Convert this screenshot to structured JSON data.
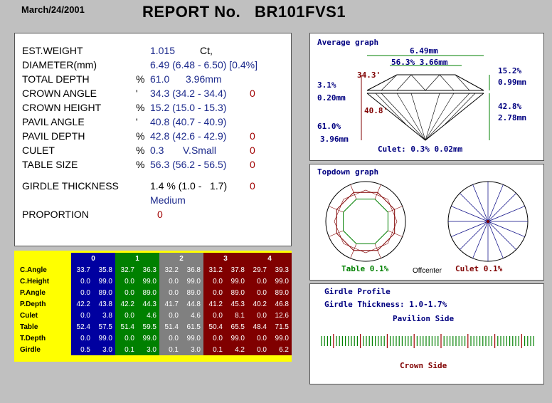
{
  "header": {
    "date": "March/24/2001",
    "title": "REPORT No.   BR101FVS1"
  },
  "measurements": [
    {
      "label": "EST.WEIGHT",
      "unit": "",
      "value": "1.015",
      "extra": "Ct,",
      "flag": ""
    },
    {
      "label": "DIAMETER(mm)",
      "unit": "",
      "value": "6.49 (6.48 - 6.50) [0.4%]",
      "extra": "",
      "flag": ""
    },
    {
      "label": "TOTAL DEPTH",
      "unit": "%",
      "value": "61.0",
      "extra": "3.96mm",
      "flag": ""
    },
    {
      "label": "CROWN ANGLE",
      "unit": "'",
      "value": "34.3 (34.2 - 34.4)",
      "extra": "",
      "flag": "0"
    },
    {
      "label": "CROWN HEIGHT",
      "unit": "%",
      "value": "15.2 (15.0 - 15.3)",
      "extra": "",
      "flag": ""
    },
    {
      "label": "PAVIL ANGLE",
      "unit": "'",
      "value": "40.8 (40.7 - 40.9)",
      "extra": "",
      "flag": ""
    },
    {
      "label": "PAVIL DEPTH",
      "unit": "%",
      "value": "42.8 (42.6 - 42.9)",
      "extra": "",
      "flag": "0"
    },
    {
      "label": "CULET",
      "unit": "%",
      "value": "0.3",
      "extra": "V.Small",
      "flag": "0"
    },
    {
      "label": "TABLE SIZE",
      "unit": "%",
      "value": "56.3 (56.2 - 56.5)",
      "extra": "",
      "flag": "0"
    }
  ],
  "girdle": {
    "label": "GIRDLE THICKNESS",
    "value": "1.4 % (1.0 -   1.7)",
    "flag": "0",
    "grade": "Medium"
  },
  "proportion": {
    "label": "PROPORTION",
    "value": "0"
  },
  "grade_table": {
    "headers": [
      "0",
      "1",
      "2",
      "3",
      "4"
    ],
    "colors": {
      "label": "#ffff00",
      "g0": "#0000a0",
      "g1": "#008000",
      "g2": "#808080",
      "g3": "#800000",
      "g4": "#800000"
    },
    "rows": [
      {
        "label": "C.Angle",
        "values": [
          "33.7",
          "35.8",
          "32.7",
          "36.3",
          "32.2",
          "36.8",
          "31.2",
          "37.8",
          "29.7",
          "39.3"
        ]
      },
      {
        "label": "C.Height",
        "values": [
          "0.0",
          "99.0",
          "0.0",
          "99.0",
          "0.0",
          "99.0",
          "0.0",
          "99.0",
          "0.0",
          "99.0"
        ]
      },
      {
        "label": "P.Angle",
        "values": [
          "0.0",
          "89.0",
          "0.0",
          "89.0",
          "0.0",
          "89.0",
          "0.0",
          "89.0",
          "0.0",
          "89.0"
        ]
      },
      {
        "label": "P.Depth",
        "values": [
          "42.2",
          "43.8",
          "42.2",
          "44.3",
          "41.7",
          "44.8",
          "41.2",
          "45.3",
          "40.2",
          "46.8"
        ]
      },
      {
        "label": "Culet",
        "values": [
          "0.0",
          "3.8",
          "0.0",
          "4.6",
          "0.0",
          "4.6",
          "0.0",
          "8.1",
          "0.0",
          "12.6"
        ]
      },
      {
        "label": "Table",
        "values": [
          "52.4",
          "57.5",
          "51.4",
          "59.5",
          "51.4",
          "61.5",
          "50.4",
          "65.5",
          "48.4",
          "71.5"
        ]
      },
      {
        "label": "T.Depth",
        "values": [
          "0.0",
          "99.0",
          "0.0",
          "99.0",
          "0.0",
          "99.0",
          "0.0",
          "99.0",
          "0.0",
          "99.0"
        ]
      },
      {
        "label": "Girdle",
        "values": [
          "0.5",
          "3.0",
          "0.1",
          "3.0",
          "0.1",
          "3.0",
          "0.1",
          "4.2",
          "0.0",
          "6.2"
        ]
      }
    ]
  },
  "average_graph": {
    "title": "Average graph",
    "diameter": "6.49mm",
    "table": "56.3% 3.66mm",
    "crown_angle": "34.3'",
    "pavilion_angle": "40.8'",
    "crown_pct": "3.1%",
    "crown_mm": "0.20mm",
    "total_pct": "61.0%",
    "total_mm": "3.96mm",
    "right_crown_pct": "15.2%",
    "right_crown_mm": "0.99mm",
    "right_pav_pct": "42.8%",
    "right_pav_mm": "2.78mm",
    "culet": "Culet: 0.3% 0.02mm"
  },
  "topdown_graph": {
    "title": "Topdown graph",
    "table_label": "Table 0.1%",
    "offcenter": "Offcenter",
    "culet_label": "Culet 0.1%"
  },
  "girdle_profile": {
    "title": "Girdle Profile",
    "thickness": "Girdle Thickness: 1.0-1.7%",
    "pavilion": "Pavilion Side",
    "crown": "Crown Side"
  }
}
